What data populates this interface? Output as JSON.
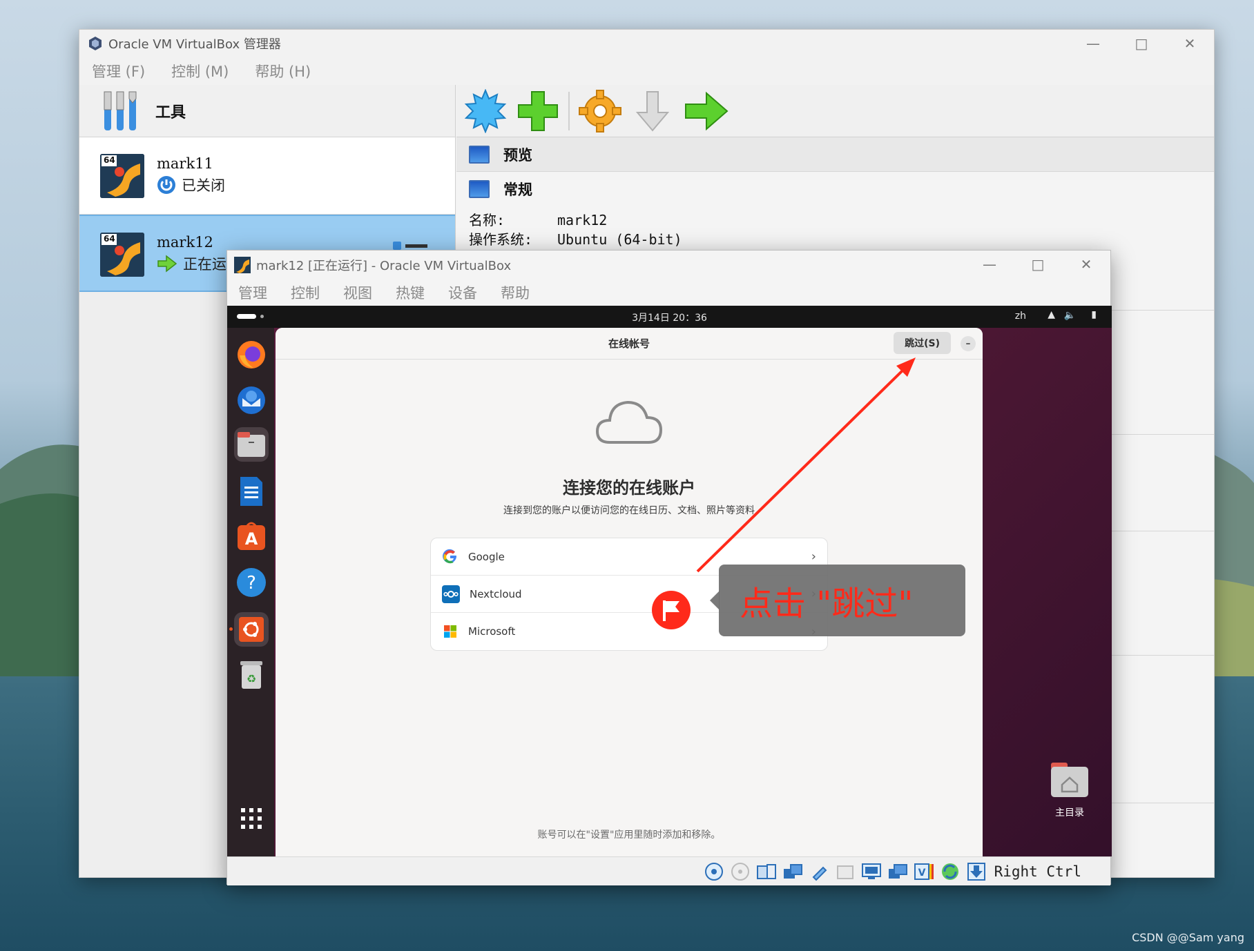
{
  "manager": {
    "title": "Oracle VM VirtualBox 管理器",
    "menu": [
      "管理 (F)",
      "控制 (M)",
      "帮助 (H)"
    ],
    "tools_label": "工具",
    "vms": [
      {
        "name": "mark11",
        "state": "已关闭",
        "badge": "64"
      },
      {
        "name": "mark12",
        "state": "正在运行",
        "badge": "64"
      }
    ],
    "toolbar_icons": [
      "new-icon",
      "add-icon",
      "settings-icon",
      "discard-icon",
      "start-icon"
    ],
    "preview_label": "预览",
    "general_label": "常规",
    "details": [
      {
        "key": "名称:",
        "value": "mark12"
      },
      {
        "key": "操作系统:",
        "value": "Ubuntu (64-bit)"
      }
    ]
  },
  "vm_window": {
    "title": "mark12 [正在运行] - Oracle VM VirtualBox",
    "menu": [
      "管理",
      "控制",
      "视图",
      "热键",
      "设备",
      "帮助"
    ],
    "host_key": "Right Ctrl"
  },
  "ubuntu": {
    "clock": "3月14日 20：36",
    "lang": "zh",
    "files_tooltip": "文件",
    "home_folder_label": "主目录"
  },
  "dialog": {
    "title": "在线帐号",
    "skip_label": "跳过(S)",
    "minimize_label": "–",
    "heading": "连接您的在线账户",
    "subtitle": "连接到您的账户以便访问您的在线日历、文档、照片等资料",
    "providers": [
      {
        "name": "Google"
      },
      {
        "name": "Nextcloud"
      },
      {
        "name": "Microsoft"
      }
    ],
    "footer": "账号可以在\"设置\"应用里随时添加和移除。"
  },
  "annotation": {
    "text": "点击 \"跳过\"",
    "color": "#ff2a1a"
  },
  "watermark": "CSDN @@Sam  yang"
}
